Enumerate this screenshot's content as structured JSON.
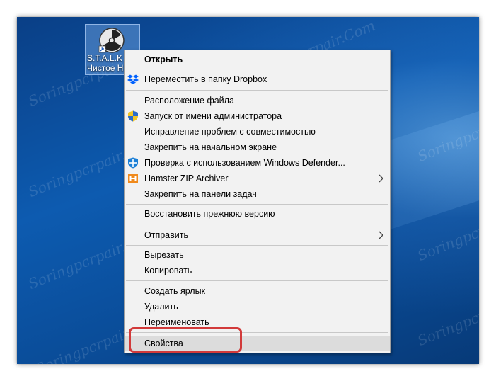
{
  "watermark": "Soringpcrpair.Com",
  "desktop_icon": {
    "name_line1": "S.T.A.L.K",
    "name_line2": "Чистое Н"
  },
  "context_menu": {
    "items": [
      {
        "label": "Открыть",
        "icon": ""
      },
      {
        "label": "Переместить в папку Dropbox",
        "icon": "dropbox-icon"
      },
      {
        "label": "Расположение файла",
        "icon": ""
      },
      {
        "label": "Запуск от имени администратора",
        "icon": "uac-shield-icon"
      },
      {
        "label": "Исправление проблем с совместимостью",
        "icon": ""
      },
      {
        "label": "Закрепить на начальном экране",
        "icon": ""
      },
      {
        "label": "Проверка с использованием Windows Defender...",
        "icon": "windows-defender-icon"
      },
      {
        "label": "Hamster ZIP Archiver",
        "icon": "hamster-zip-icon",
        "submenu": true
      },
      {
        "label": "Закрепить на панели задач",
        "icon": ""
      },
      {
        "label": "Восстановить прежнюю версию",
        "icon": ""
      },
      {
        "label": "Отправить",
        "icon": "",
        "submenu": true
      },
      {
        "label": "Вырезать",
        "icon": ""
      },
      {
        "label": "Копировать",
        "icon": ""
      },
      {
        "label": "Создать ярлык",
        "icon": ""
      },
      {
        "label": "Удалить",
        "icon": ""
      },
      {
        "label": "Переименовать",
        "icon": ""
      },
      {
        "label": "Свойства",
        "icon": "",
        "highlighted": true
      }
    ]
  },
  "colors": {
    "highlight_outline": "#d23a3a",
    "menu_background": "#f2f2f2"
  }
}
